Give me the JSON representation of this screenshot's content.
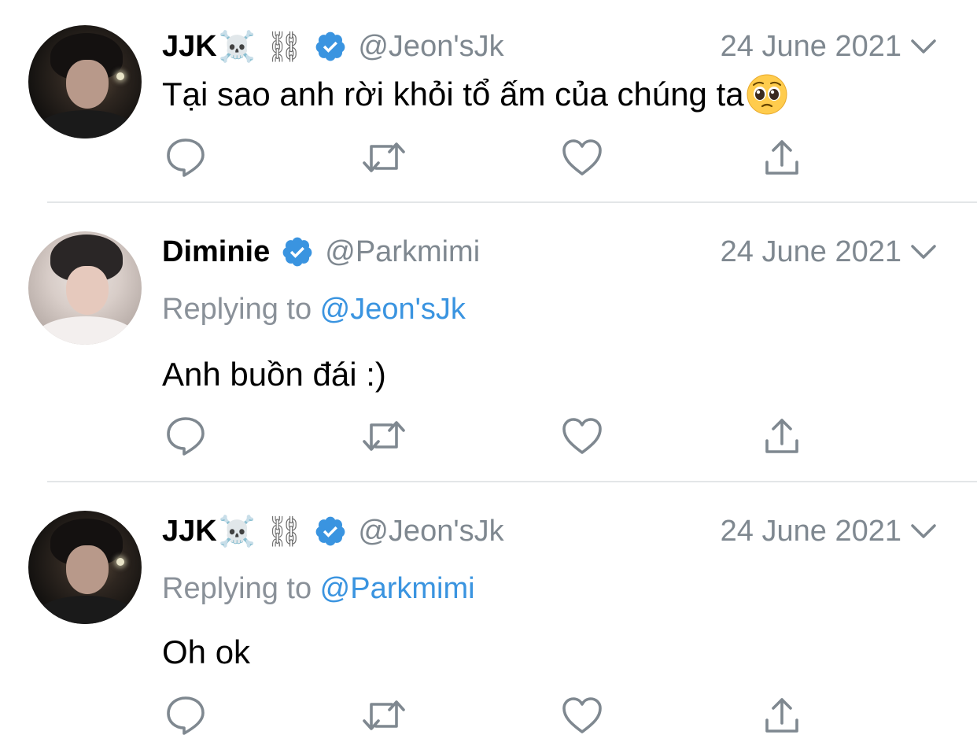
{
  "colors": {
    "accent": "#3a94e0",
    "secondary_text": "#7f8890",
    "icon": "#7f8890",
    "divider": "#e3e6e8",
    "verified": "#3a94e0"
  },
  "tweets": [
    {
      "display_name": "JJK",
      "name_decoration": "☠️ ⛓",
      "handle": "@Jeon'sJk",
      "date": "24 June 2021",
      "verified": true,
      "replying_prefix": "",
      "replying_to": "",
      "text": "Tại sao anh rời khỏi tổ ấm của chúng ta",
      "emoji": "pleading-face"
    },
    {
      "display_name": "Diminie",
      "name_decoration": "",
      "handle": "@Parkmimi",
      "date": "24 June 2021",
      "verified": true,
      "replying_prefix": "Replying to ",
      "replying_to": "@Jeon'sJk",
      "text": "Anh buồn đái :)"
    },
    {
      "display_name": "JJK",
      "name_decoration": "☠️ ⛓",
      "handle": "@Jeon'sJk",
      "date": "24 June 2021",
      "verified": true,
      "replying_prefix": "Replying to ",
      "replying_to": "@Parkmimi",
      "text": "Oh ok"
    }
  ],
  "icons": {
    "reply": "reply-icon",
    "retweet": "retweet-icon",
    "like": "heart-icon",
    "share": "share-icon",
    "verified": "verified-badge-icon",
    "more": "chevron-down-icon"
  }
}
